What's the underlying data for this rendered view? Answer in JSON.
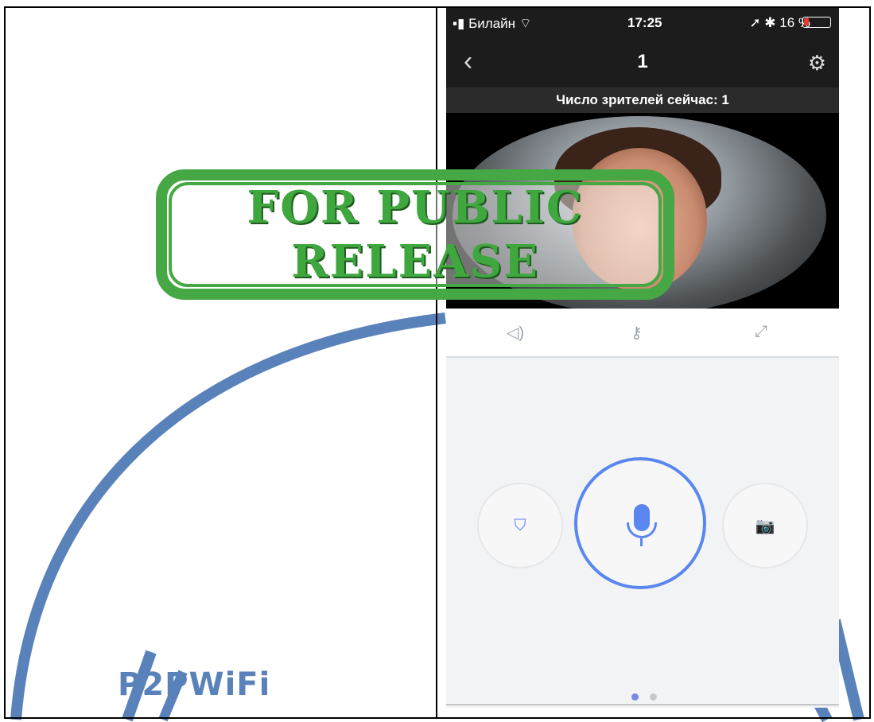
{
  "watermark": {
    "brand_text": "P2PWiFi",
    "color": "#5a82ba"
  },
  "status_bar": {
    "carrier": "Билайн",
    "time": "17:25",
    "battery": "16 %",
    "battery_color": "#e53935"
  },
  "nav": {
    "title": "1",
    "back_icon": "chevron-left-icon",
    "settings_icon": "gear-icon"
  },
  "viewers_label": "Число зрителей сейчас: 1",
  "video": {
    "description_icon": "camera-feed"
  },
  "toolbar": {
    "icons": [
      "speaker-icon",
      "key-icon",
      "fullscreen-icon"
    ]
  },
  "actions": {
    "left_icon": "shield-off-icon",
    "center_icon": "microphone-icon",
    "right_icon": "camera-icon",
    "accent": "#5a86f0"
  },
  "pager": {
    "active_color": "#7b88e8",
    "inactive_color": "#c8c8c8",
    "active_index": 0,
    "count": 2
  },
  "stamp": {
    "line1": "FOR PUBLIC",
    "line2": "RELEASE",
    "color": "#45a845"
  }
}
